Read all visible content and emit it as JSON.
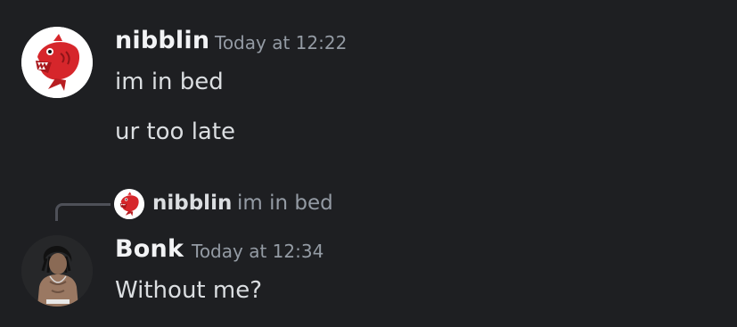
{
  "messages": [
    {
      "author": "nibblin",
      "timestamp": "Today at 12:22",
      "avatar_icon": "piranha-avatar-icon",
      "lines": [
        "im in bed",
        "ur too late"
      ]
    },
    {
      "author": "Bonk",
      "timestamp": "Today at 12:34",
      "avatar_icon": "person-avatar-icon",
      "reply": {
        "author": "nibblin",
        "text": "im in bed"
      },
      "lines": [
        "Without me?"
      ]
    }
  ],
  "colors": {
    "background": "#1e1f22",
    "username": "#f2f3f5",
    "timestamp": "#949ba4",
    "text": "#dbdee1",
    "piranha_red": "#d6262b"
  }
}
